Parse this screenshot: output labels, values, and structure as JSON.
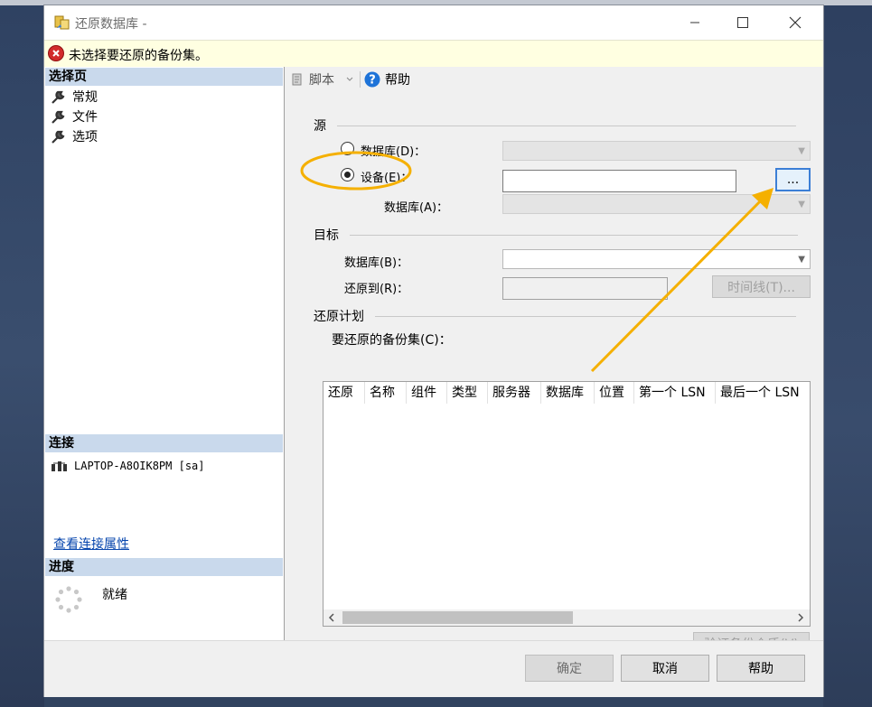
{
  "window": {
    "title": "还原数据库 -",
    "controls": {
      "minimize": "—",
      "maximize": "☐",
      "close": "✕"
    }
  },
  "error_bar": {
    "message": "未选择要还原的备份集。",
    "icon": "error-icon"
  },
  "left": {
    "select_page_header": "选择页",
    "pages": [
      {
        "label": "常规",
        "icon": "wrench-icon"
      },
      {
        "label": "文件",
        "icon": "wrench-icon"
      },
      {
        "label": "选项",
        "icon": "wrench-icon"
      }
    ],
    "connection_header": "连接",
    "connection_name": "LAPTOP-A8OIK8PM [sa]",
    "view_connection_link": "查看连接属性",
    "progress_header": "进度",
    "progress_status": "就绪"
  },
  "toolbar": {
    "script_label": "脚本",
    "help_label": "帮助"
  },
  "source": {
    "group_label": "源",
    "database_radio": "数据库(D)：",
    "device_radio": "设备(E)：",
    "device_value": "",
    "browse_button": "...",
    "database_label": "数据库(A)：",
    "selected": "device"
  },
  "target": {
    "group_label": "目标",
    "database_label": "数据库(B)：",
    "database_value": "",
    "restore_to_label": "还原到(R)：",
    "restore_to_value": "",
    "timeline_button": "时间线(T)..."
  },
  "plan": {
    "group_label": "还原计划",
    "backup_sets_label": "要还原的备份集(C)：",
    "columns": [
      "还原",
      "名称",
      "组件",
      "类型",
      "服务器",
      "数据库",
      "位置",
      "第一个 LSN",
      "最后一个 LSN"
    ],
    "verify_button": "验证备份介质(V)"
  },
  "footer": {
    "ok_button": "确定",
    "cancel_button": "取消",
    "help_button": "帮助"
  },
  "colors": {
    "annotation": "#f5b000",
    "section_header": "#c9d9ec",
    "error": "#d22b2b",
    "link": "#0645ad"
  }
}
